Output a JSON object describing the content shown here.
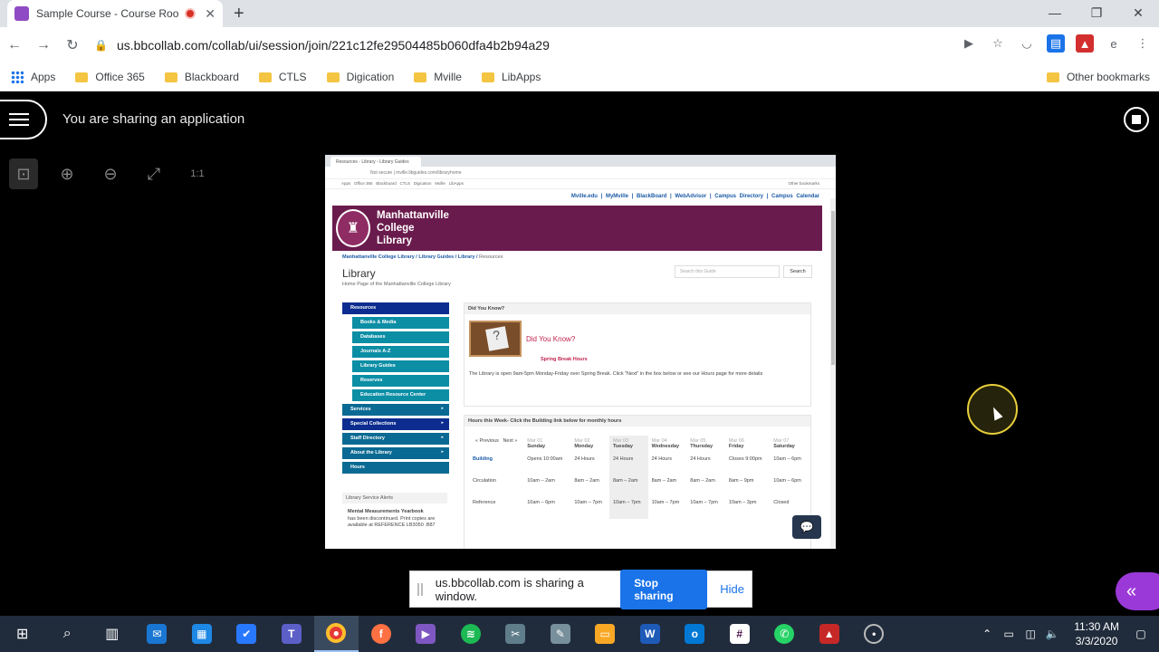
{
  "browser": {
    "tab_title": "Sample Course - Course Roo",
    "url": "us.bbcollab.com/collab/ui/session/join/221c12fe29504485b060dfa4b2b94a29",
    "bookmarks": [
      "Apps",
      "Office 365",
      "Blackboard",
      "CTLS",
      "Digication",
      "Mville",
      "LibApps"
    ],
    "other_bookmarks": "Other bookmarks"
  },
  "collab": {
    "sharing_label": "You are sharing an application",
    "zoom_fit_label": "1:1"
  },
  "shared_window": {
    "tab_title": "Resources - Library - Library Guides",
    "url": "Not secure | mville.libguides.com/libraryhome",
    "bookmarks": [
      "Apps",
      "Office 365",
      "Blackboard",
      "CTLS",
      "Digication",
      "Mville",
      "LibApps",
      "Other bookmarks"
    ],
    "top_links": [
      "Mville.edu",
      "MyMville",
      "BlackBoard",
      "WebAdvisor",
      "Campus Directory",
      "Campus Calendar"
    ],
    "banner_lines": [
      "Manhattanville",
      "College",
      "Library"
    ],
    "breadcrumbs": [
      "Manhattanville College Library",
      "Library Guides",
      "Library",
      "Resources"
    ],
    "guide_title": "Library",
    "guide_subtitle": "Home Page of the Manhattanville College Library",
    "search_placeholder": "Search this Guide",
    "search_button": "Search",
    "nav": [
      {
        "label": "Resources",
        "sub": false,
        "dark": true,
        "has": false
      },
      {
        "label": "Books & Media",
        "sub": true,
        "dark": false,
        "has": false
      },
      {
        "label": "Databases",
        "sub": true,
        "dark": false,
        "has": false
      },
      {
        "label": "Journals A-Z",
        "sub": true,
        "dark": false,
        "has": false
      },
      {
        "label": "Library Guides",
        "sub": true,
        "dark": false,
        "has": false
      },
      {
        "label": "Reserves",
        "sub": true,
        "dark": false,
        "has": false
      },
      {
        "label": "Education Resource Center",
        "sub": true,
        "dark": false,
        "has": false
      },
      {
        "label": "Services",
        "sub": false,
        "dark": false,
        "has": true
      },
      {
        "label": "Special Collections",
        "sub": false,
        "dark": true,
        "has": true
      },
      {
        "label": "Staff Directory",
        "sub": false,
        "dark": false,
        "has": true
      },
      {
        "label": "About the Library",
        "sub": false,
        "dark": false,
        "has": true
      },
      {
        "label": "Hours",
        "sub": false,
        "dark": false,
        "has": false
      }
    ],
    "alerts_heading": "Library Service Alerts",
    "alert_title": "Mental Measurements Yearbook",
    "alert_body": "has been discontinued. Print copies are available at REFERENCE LB3050 .B87",
    "dyk_heading": "Did You Know?",
    "dyk_title": "Did You Know?",
    "spring_break": "Spring Break Hours",
    "dyk_text": "The Library is open 9am-5pm Monday-Friday over Spring Break.  Click \"Next\" in the box below or see our Hours page for more details",
    "hours_heading": "Hours this Week- Click the Building link below for monthly hours",
    "prev_label": "« Previous",
    "next_label": "Next »",
    "dates": [
      "Mar 01",
      "Mar 02",
      "Mar 03",
      "Mar 04",
      "Mar 05",
      "Mar 06",
      "Mar 07"
    ],
    "days": [
      "Sunday",
      "Monday",
      "Tuesday",
      "Wednesday",
      "Thursday",
      "Friday",
      "Saturday"
    ],
    "hours_rows": [
      {
        "label": "Building",
        "cells": [
          "Opens 10:00am",
          "24 Hours",
          "24 Hours",
          "24 Hours",
          "24 Hours",
          "Closes 9:00pm",
          "10am – 6pm"
        ]
      },
      {
        "label": "Circulation",
        "cells": [
          "10am – 2am",
          "8am – 2am",
          "8am – 2am",
          "8am – 2am",
          "8am – 2am",
          "8am – 9pm",
          "10am – 6pm"
        ]
      },
      {
        "label": "Reference",
        "cells": [
          "10am – 6pm",
          "10am – 7pm",
          "10am – 7pm",
          "10am – 7pm",
          "10am – 7pm",
          "10am – 3pm",
          "Closed"
        ]
      }
    ]
  },
  "share_notice": {
    "text": "us.bbcollab.com is sharing a window.",
    "stop_label": "Stop sharing",
    "hide_label": "Hide"
  },
  "taskbar": {
    "time": "11:30 AM",
    "date": "3/3/2020"
  },
  "colors": {
    "banner": "#6a1b4d",
    "nav_blue": "#0b6a93",
    "stop_button": "#1a73e8",
    "collapse_button": "#9b39d8",
    "taskbar": "#202c3c"
  }
}
